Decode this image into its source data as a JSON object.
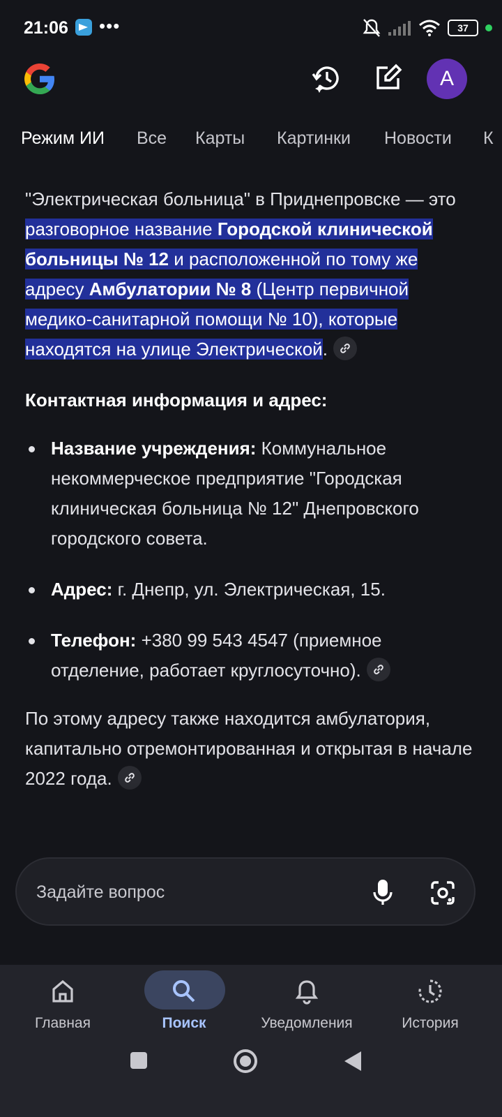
{
  "status_bar": {
    "time": "21:06",
    "dots": "•••",
    "battery": "37"
  },
  "header": {
    "avatar_letter": "A"
  },
  "tabs": [
    "Режим ИИ",
    "Все",
    "Карты",
    "Картинки",
    "Новости",
    "К"
  ],
  "content": {
    "intro": {
      "p1": "\"Электрическая больница\" в Приднепровске — это ",
      "p2": "разговорное название ",
      "p3": "Городской клинической больницы № 12",
      "p4": " и расположенной по тому же адресу ",
      "p5": "Амбулатории № 8",
      "p6": " (Центр первичной медико-санитарной помощи № 10), которые находятся на улице Электрической",
      "p7": "."
    },
    "subheading": "Контактная информация и адрес:",
    "bullets": [
      {
        "label": "Название учреждения:",
        "text": " Коммунальное некоммерческое предприятие \"Городская клиническая больница № 12\" Днепровского городского совета."
      },
      {
        "label": "Адрес:",
        "text": " г. Днепр, ул. Электрическая, 15."
      },
      {
        "label": "Телефон:",
        "text": " +380 99 543 4547 (приемное отделение, работает круглосуточно)."
      }
    ],
    "footer_para": "По этому адресу также находится амбулатория, капитально отремонтированная и открытая в начале 2022 года."
  },
  "ask_bar": {
    "placeholder": "Задайте вопрос"
  },
  "bottom_nav": [
    {
      "label": "Главная",
      "icon": "home-icon"
    },
    {
      "label": "Поиск",
      "icon": "search-icon"
    },
    {
      "label": "Уведомления",
      "icon": "bell-icon"
    },
    {
      "label": "История",
      "icon": "history-icon"
    }
  ],
  "colors": {
    "background": "#14151a",
    "highlight": "#22309a",
    "avatar": "#6232b3",
    "active_nav": "#a8c4ff"
  }
}
